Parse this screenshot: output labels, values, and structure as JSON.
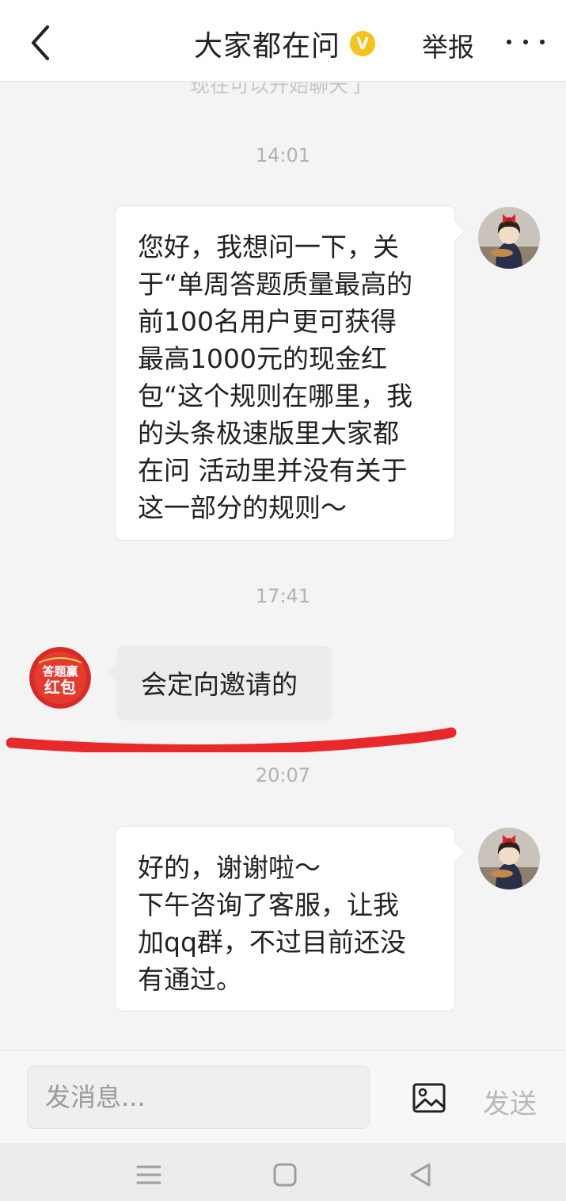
{
  "header": {
    "title": "大家都在问",
    "verified_badge": "V",
    "report_label": "举报",
    "back_icon": "chevron-left-icon",
    "more_icon": "more-dots-icon"
  },
  "chat": {
    "faded_text": "现在可以开始聊天了",
    "messages": [
      {
        "timestamp": "14:01",
        "sender": "me",
        "text": "您好，我想问一下，关\n于“单周答题质量最高的\n前100名用户更可获得\n最高1000元的现金红\n包“这个规则在哪里，我\n的头条极速版里大家都\n在问 活动里并没有关于\n这一部分的规则～"
      },
      {
        "timestamp": "17:41",
        "sender": "other",
        "avatar_text": "答题赢\n红包",
        "text": "会定向邀请的"
      },
      {
        "timestamp": "20:07",
        "sender": "me",
        "text": "好的，谢谢啦～\n下午咨询了客服，让我\n加qq群，不过目前还没\n有通过。"
      }
    ]
  },
  "input_bar": {
    "placeholder": "发消息...",
    "image_icon": "image-icon",
    "send_label": "发送"
  },
  "nav_bar": {
    "icons": [
      "menu-icon",
      "home-square-icon",
      "back-triangle-icon"
    ]
  },
  "colors": {
    "badge": "#f6c21b",
    "annotation_red": "#e8282b",
    "send_disabled": "#b9b9b9",
    "timestamp": "#b2b2b2"
  }
}
